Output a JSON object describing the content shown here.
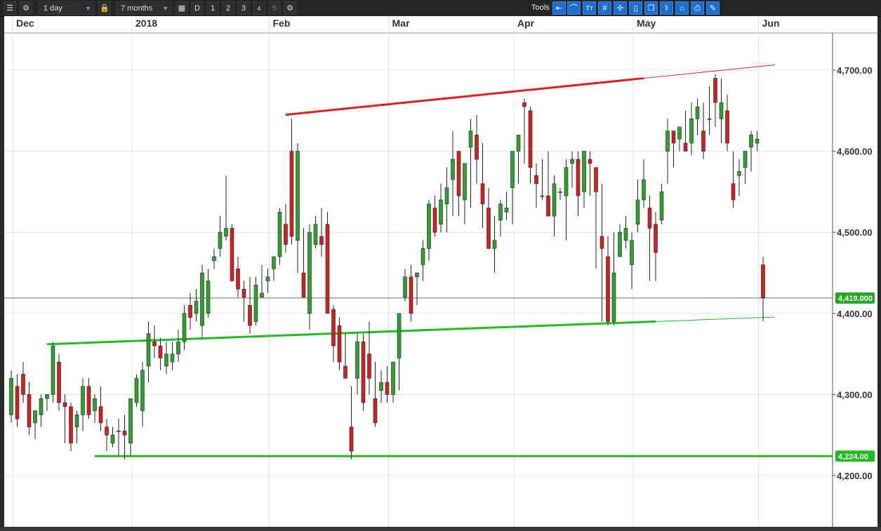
{
  "toolbar": {
    "interval": "1 day",
    "range": "7 months",
    "btn_d": "D",
    "btn_1": "1",
    "btn_2": "2",
    "btn_3": "3",
    "btn_4": "4",
    "btn_5": "5",
    "tools_label": "Tools"
  },
  "chart_data": {
    "type": "candlestick",
    "x_axis_labels": [
      {
        "label": "Dec",
        "index": 0
      },
      {
        "label": "2018",
        "index": 20
      },
      {
        "label": "Feb",
        "index": 43
      },
      {
        "label": "Mar",
        "index": 63
      },
      {
        "label": "Apr",
        "index": 84
      },
      {
        "label": "May",
        "index": 104
      },
      {
        "label": "Jun",
        "index": 125
      }
    ],
    "y_ticks": [
      "4,700.00",
      "4,600.00",
      "4,500.00",
      "4,400.00",
      "4,300.00",
      "4,200.00"
    ],
    "y_tick_values": [
      4700,
      4600,
      4500,
      4400,
      4300,
      4200
    ],
    "ylim": [
      4175,
      4745
    ],
    "current_price": {
      "label": "4,419.000",
      "value": 4419,
      "color": "#22aa22"
    },
    "support_level": {
      "label": "4,224.00",
      "value": 4224,
      "color": "#22bb22"
    },
    "up_color": "#2ea02e",
    "down_color": "#d12020",
    "ohlc": [
      [
        4275,
        4330,
        4265,
        4320
      ],
      [
        4310,
        4325,
        4260,
        4270
      ],
      [
        4325,
        4340,
        4290,
        4300
      ],
      [
        4300,
        4315,
        4250,
        4260
      ],
      [
        4265,
        4280,
        4245,
        4280
      ],
      [
        4275,
        4300,
        4260,
        4295
      ],
      [
        4295,
        4300,
        4280,
        4300
      ],
      [
        4300,
        4365,
        4290,
        4360
      ],
      [
        4340,
        4350,
        4280,
        4290
      ],
      [
        4290,
        4300,
        4240,
        4285
      ],
      [
        4285,
        4290,
        4230,
        4240
      ],
      [
        4260,
        4280,
        4240,
        4275
      ],
      [
        4275,
        4320,
        4255,
        4310
      ],
      [
        4310,
        4320,
        4270,
        4275
      ],
      [
        4280,
        4300,
        4265,
        4295
      ],
      [
        4285,
        4310,
        4255,
        4265
      ],
      [
        4260,
        4270,
        4230,
        4250
      ],
      [
        4240,
        4260,
        4235,
        4250
      ],
      [
        4255,
        4270,
        4225,
        4255
      ],
      [
        4255,
        4275,
        4220,
        4250
      ],
      [
        4240,
        4295,
        4225,
        4295
      ],
      [
        4290,
        4325,
        4285,
        4320
      ],
      [
        4280,
        4340,
        4260,
        4330
      ],
      [
        4335,
        4390,
        4315,
        4375
      ],
      [
        4365,
        4385,
        4345,
        4360
      ],
      [
        4360,
        4370,
        4330,
        4345
      ],
      [
        4335,
        4365,
        4325,
        4350
      ],
      [
        4340,
        4365,
        4330,
        4350
      ],
      [
        4350,
        4380,
        4340,
        4365
      ],
      [
        4365,
        4410,
        4355,
        4400
      ],
      [
        4410,
        4425,
        4380,
        4395
      ],
      [
        4400,
        4430,
        4390,
        4415
      ],
      [
        4385,
        4460,
        4370,
        4450
      ],
      [
        4400,
        4455,
        4395,
        4440
      ],
      [
        4465,
        4480,
        4455,
        4470
      ],
      [
        4480,
        4520,
        4470,
        4500
      ],
      [
        4495,
        4570,
        4490,
        4505
      ],
      [
        4505,
        4510,
        4440,
        4440
      ],
      [
        4455,
        4470,
        4420,
        4430
      ],
      [
        4430,
        4440,
        4390,
        4420
      ],
      [
        4410,
        4445,
        4375,
        4385
      ],
      [
        4390,
        4445,
        4385,
        4435
      ],
      [
        4420,
        4460,
        4420,
        4425
      ],
      [
        4440,
        4455,
        4425,
        4445
      ],
      [
        4455,
        4470,
        4440,
        4470
      ],
      [
        4470,
        4530,
        4460,
        4525
      ],
      [
        4510,
        4535,
        4475,
        4485
      ],
      [
        4600,
        4640,
        4485,
        4495
      ],
      [
        4490,
        4610,
        4450,
        4600
      ],
      [
        4450,
        4505,
        4430,
        4420
      ],
      [
        4400,
        4510,
        4380,
        4500
      ],
      [
        4485,
        4520,
        4480,
        4510
      ],
      [
        4495,
        4530,
        4470,
        4485
      ],
      [
        4510,
        4525,
        4400,
        4400
      ],
      [
        4405,
        4410,
        4340,
        4360
      ],
      [
        4385,
        4395,
        4330,
        4340
      ],
      [
        4335,
        4375,
        4320,
        4320
      ],
      [
        4260,
        4310,
        4220,
        4230
      ],
      [
        4320,
        4375,
        4300,
        4365
      ],
      [
        4365,
        4375,
        4280,
        4290
      ],
      [
        4350,
        4390,
        4300,
        4320
      ],
      [
        4295,
        4340,
        4260,
        4265
      ],
      [
        4305,
        4330,
        4290,
        4315
      ],
      [
        4315,
        4335,
        4290,
        4300
      ],
      [
        4300,
        4340,
        4290,
        4340
      ],
      [
        4345,
        4400,
        4305,
        4400
      ],
      [
        4420,
        4455,
        4415,
        4445
      ],
      [
        4445,
        4460,
        4390,
        4400
      ],
      [
        4445,
        4450,
        4410,
        4450
      ],
      [
        4460,
        4490,
        4440,
        4480
      ],
      [
        4480,
        4540,
        4465,
        4535
      ],
      [
        4530,
        4545,
        4495,
        4500
      ],
      [
        4510,
        4560,
        4500,
        4540
      ],
      [
        4535,
        4580,
        4500,
        4555
      ],
      [
        4565,
        4625,
        4520,
        4590
      ],
      [
        4600,
        4600,
        4520,
        4545
      ],
      [
        4540,
        4575,
        4510,
        4585
      ],
      [
        4605,
        4640,
        4530,
        4625
      ],
      [
        4620,
        4645,
        4560,
        4590
      ],
      [
        4560,
        4610,
        4505,
        4535
      ],
      [
        4530,
        4555,
        4480,
        4480
      ],
      [
        4480,
        4520,
        4450,
        4490
      ],
      [
        4515,
        4540,
        4495,
        4535
      ],
      [
        4525,
        4550,
        4515,
        4530
      ],
      [
        4555,
        4570,
        4510,
        4600
      ],
      [
        4600,
        4620,
        4560,
        4620
      ],
      [
        4660,
        4665,
        4585,
        4655
      ],
      [
        4650,
        4655,
        4560,
        4580
      ],
      [
        4570,
        4585,
        4530,
        4560
      ],
      [
        4545,
        4590,
        4540,
        4545
      ],
      [
        4545,
        4600,
        4530,
        4520
      ],
      [
        4520,
        4570,
        4495,
        4560
      ],
      [
        4550,
        4555,
        4540,
        4550
      ],
      [
        4545,
        4590,
        4490,
        4580
      ],
      [
        4585,
        4600,
        4555,
        4590
      ],
      [
        4590,
        4600,
        4520,
        4545
      ],
      [
        4550,
        4580,
        4530,
        4600
      ],
      [
        4590,
        4600,
        4545,
        4585
      ],
      [
        4580,
        4580,
        4455,
        4550
      ],
      [
        4495,
        4560,
        4390,
        4480
      ],
      [
        4470,
        4495,
        4385,
        4390
      ],
      [
        4390,
        4500,
        4385,
        4450
      ],
      [
        4470,
        4510,
        4470,
        4500
      ],
      [
        4490,
        4520,
        4480,
        4505
      ],
      [
        4460,
        4500,
        4430,
        4490
      ],
      [
        4510,
        4565,
        4500,
        4540
      ],
      [
        4540,
        4590,
        4530,
        4565
      ],
      [
        4530,
        4545,
        4440,
        4505
      ],
      [
        4510,
        4525,
        4440,
        4475
      ],
      [
        4515,
        4560,
        4510,
        4550
      ],
      [
        4600,
        4640,
        4560,
        4625
      ],
      [
        4625,
        4625,
        4580,
        4610
      ],
      [
        4615,
        4630,
        4600,
        4630
      ],
      [
        4610,
        4650,
        4600,
        4600
      ],
      [
        4610,
        4660,
        4595,
        4640
      ],
      [
        4640,
        4665,
        4620,
        4655
      ],
      [
        4625,
        4660,
        4590,
        4600
      ],
      [
        4640,
        4680,
        4620,
        4640
      ],
      [
        4690,
        4695,
        4630,
        4660
      ],
      [
        4640,
        4690,
        4610,
        4660
      ],
      [
        4650,
        4670,
        4600,
        4610
      ],
      [
        4560,
        4600,
        4530,
        4540
      ],
      [
        4570,
        4590,
        4545,
        4575
      ],
      [
        4580,
        4600,
        4560,
        4600
      ],
      [
        4605,
        4625,
        4575,
        4620
      ],
      [
        4610,
        4625,
        4600,
        4615
      ],
      [
        4460,
        4470,
        4390,
        4419
      ]
    ],
    "trendlines": [
      {
        "name": "resistance",
        "color": "#e02020",
        "x1": 46,
        "y1": 4645,
        "x2": 106,
        "y2": 4690,
        "extend_to": 128
      },
      {
        "name": "rising-support",
        "color": "#22bb22",
        "x1": 6,
        "y1": 4362,
        "x2": 108,
        "y2": 4390,
        "extend_to": 128
      }
    ]
  }
}
